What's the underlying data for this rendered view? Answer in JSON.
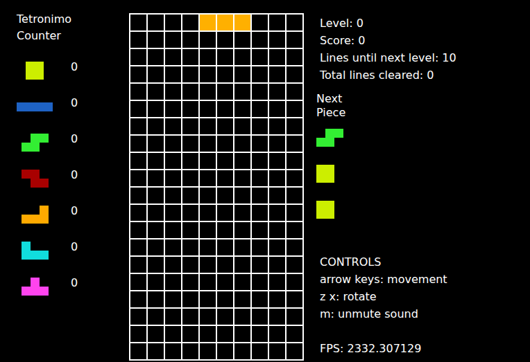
{
  "counter": {
    "title": "Tetronimo Counter",
    "pieces": [
      {
        "kind": "O",
        "color": "#ccee00",
        "count": "0"
      },
      {
        "kind": "I",
        "color": "#1e62c4",
        "count": "0"
      },
      {
        "kind": "S",
        "color": "#33ee33",
        "count": "0"
      },
      {
        "kind": "Z",
        "color": "#a80000",
        "count": "0"
      },
      {
        "kind": "L",
        "color": "#ffaa00",
        "count": "0"
      },
      {
        "kind": "J",
        "color": "#11dddd",
        "count": "0"
      },
      {
        "kind": "T",
        "color": "#ff44ee",
        "count": "0"
      }
    ]
  },
  "board": {
    "columns": 10,
    "rows": 20,
    "cells": [
      {
        "row": 0,
        "col": 4,
        "color": "#ffb000"
      },
      {
        "row": 0,
        "col": 5,
        "color": "#ffb000"
      },
      {
        "row": 0,
        "col": 6,
        "color": "#ffb000"
      }
    ]
  },
  "stats": [
    "Level: 0",
    "Score: 0",
    "Lines until next level: 10",
    "Total lines cleared: 0"
  ],
  "next": {
    "title": "Next Piece",
    "pieces": [
      {
        "kind": "S",
        "color": "#33ee33"
      },
      {
        "kind": "O",
        "color": "#ccee00"
      },
      {
        "kind": "O",
        "color": "#ccee00"
      }
    ]
  },
  "controls": [
    "CONTROLS",
    "arrow keys: movement",
    "z x: rotate",
    "m: unmute sound"
  ],
  "fps": "FPS: 2332.307129"
}
